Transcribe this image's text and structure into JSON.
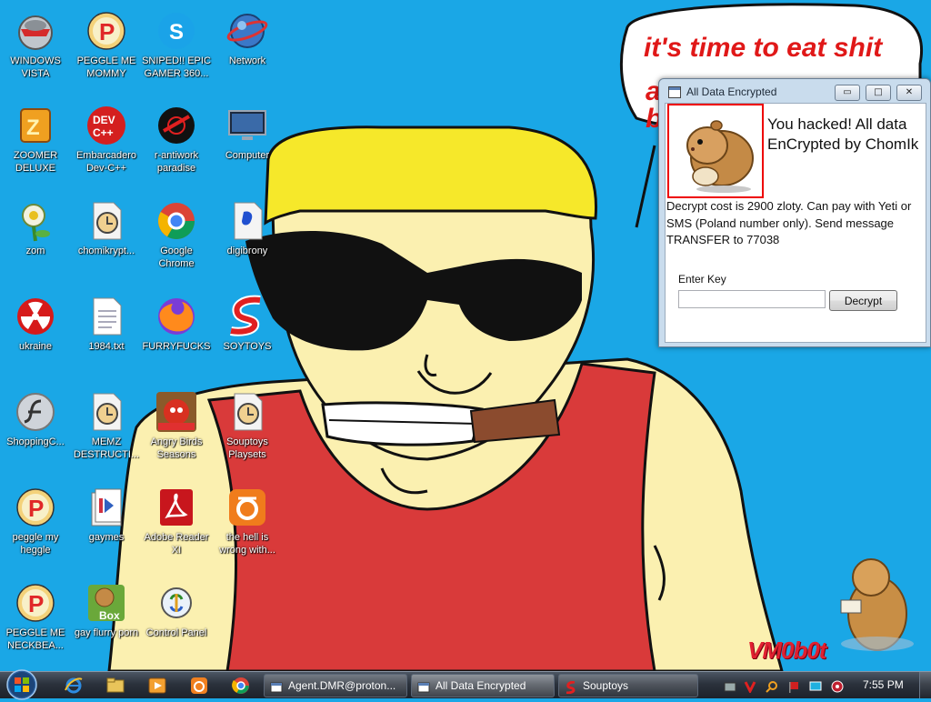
{
  "desktop": {
    "icons": [
      {
        "label": "WINDOWS VISTA",
        "icon": "vista-icon"
      },
      {
        "label": "PEGGLE ME MOMMY",
        "icon": "peggle-icon"
      },
      {
        "label": "SNIPED!! EPIC GAMER 360...",
        "icon": "skype-icon"
      },
      {
        "label": "Network",
        "icon": "network-icon"
      },
      {
        "label": "ZOOMER DELUXE",
        "icon": "zoomer-icon"
      },
      {
        "label": "Embarcadero Dev-C++",
        "icon": "devcpp-icon"
      },
      {
        "label": "r-antiwork paradise",
        "icon": "antiwork-icon"
      },
      {
        "label": "Computer",
        "icon": "computer-icon"
      },
      {
        "label": "zom",
        "icon": "zombie-plant-icon"
      },
      {
        "label": "chomikrypt...",
        "icon": "hourglass-file-icon"
      },
      {
        "label": "Google Chrome",
        "icon": "chrome-icon"
      },
      {
        "label": "digibrony",
        "icon": "digibrony-icon"
      },
      {
        "label": "ukraine",
        "icon": "radiation-icon"
      },
      {
        "label": "1984.txt",
        "icon": "text-file-icon"
      },
      {
        "label": "FURRYFUCKS",
        "icon": "firefox-icon"
      },
      {
        "label": "SOYTOYS",
        "icon": "soytoys-icon"
      },
      {
        "label": "ShoppingC...",
        "icon": "flash-icon"
      },
      {
        "label": "MEMZ DESTRUCTI...",
        "icon": "hourglass-file-icon"
      },
      {
        "label": "Angry Birds Seasons",
        "icon": "angry-birds-icon"
      },
      {
        "label": "Souptoys Playsets",
        "icon": "hourglass-file-icon"
      },
      {
        "label": "peggle my heggle",
        "icon": "peggle-icon"
      },
      {
        "label": "gaymes",
        "icon": "games-folder-icon"
      },
      {
        "label": "Adobe Reader XI",
        "icon": "adobe-reader-icon"
      },
      {
        "label": "the hell is wrong with...",
        "icon": "uc-browser-icon"
      },
      {
        "label": "PEGGLE ME NECKBEA...",
        "icon": "peggle-icon"
      },
      {
        "label": "gay flurry porn",
        "icon": "box-hamster-icon"
      },
      {
        "label": "Control Panel",
        "icon": "control-panel-icon"
      }
    ],
    "speech_bubble_text": "it's time to eat shit",
    "watermark": "VM0b0t"
  },
  "dialog": {
    "title": "All Data Encrypted",
    "heading": "You hacked! All data EnCrypted by ChomIk",
    "message": "Decrypt cost is 2900 zloty. Can pay with Yeti or SMS (Poland number only). Send message TRANSFER to 77038",
    "key_label": "Enter Key",
    "key_value": "",
    "decrypt_button": "Decrypt",
    "minimize_glyph": "▭",
    "maximize_glyph": "□",
    "close_glyph": "✕"
  },
  "taskbar": {
    "quick_launch": [
      "internet-explorer-icon",
      "windows-explorer-icon",
      "media-player-icon",
      "uc-browser-icon",
      "chrome-icon"
    ],
    "tasks": [
      {
        "label": "Agent.DMR@proton...",
        "icon": "window-icon"
      },
      {
        "label": "All Data Encrypted",
        "icon": "window-icon"
      },
      {
        "label": "Souptoys",
        "icon": "soytoys-icon"
      }
    ],
    "tray_icons": [
      "hardware-icon",
      "v-icon",
      "search-tray-icon",
      "flag-icon",
      "display-icon",
      "media-tray-icon"
    ],
    "clock": "7:55 PM"
  },
  "colors": {
    "desktop_bg": "#1aa7e6",
    "alert_red": "#e01818",
    "shirt_red": "#d93a3a",
    "skin": "#fbf0b0",
    "cap_yellow": "#f6e82a"
  }
}
